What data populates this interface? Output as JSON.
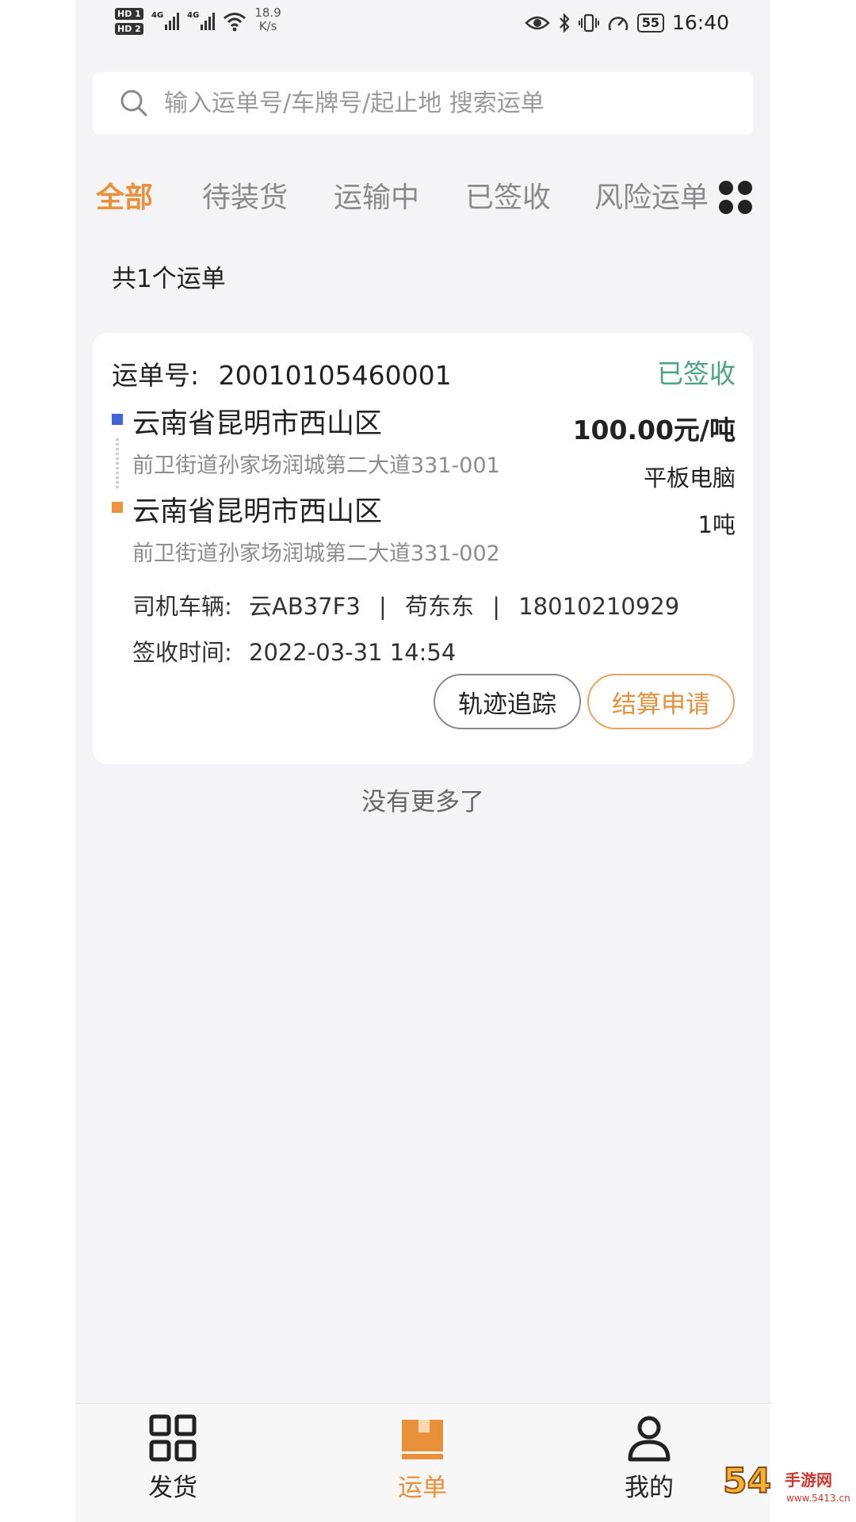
{
  "status_bar": {
    "sim1": "HD 1",
    "sim2": "HD 2",
    "net1": "4G",
    "net2": "4G",
    "speed_value": "18.9",
    "speed_unit": "K/s",
    "battery": "55",
    "time": "16:40"
  },
  "search": {
    "placeholder": "输入运单号/车牌号/起止地 搜索运单"
  },
  "tabs": [
    {
      "label": "全部",
      "active": true
    },
    {
      "label": "待装货",
      "active": false
    },
    {
      "label": "运输中",
      "active": false
    },
    {
      "label": "已签收",
      "active": false
    },
    {
      "label": "风险运单",
      "active": false
    }
  ],
  "summary": {
    "count_text": "共1个运单"
  },
  "waybill": {
    "number_label": "运单号:",
    "number": "20010105460001",
    "status": "已签收",
    "origin": {
      "city": "云南省昆明市西山区",
      "address": "前卫街道孙家场润城第二大道331-001"
    },
    "destination": {
      "city": "云南省昆明市西山区",
      "address": "前卫街道孙家场润城第二大道331-002"
    },
    "price": "100.00元/吨",
    "goods": "平板电脑",
    "weight": "1吨",
    "driver_label": "司机车辆:",
    "plate": "云AB37F3",
    "driver_name": "苟东东",
    "phone": "18010210929",
    "sign_label": "签收时间:",
    "sign_time": "2022-03-31 14:54",
    "track_button": "轨迹追踪",
    "settle_button": "结算申请"
  },
  "footer_text": "没有更多了",
  "bottom_nav": [
    {
      "label": "发货",
      "icon": "grid-apps-icon",
      "active": false
    },
    {
      "label": "运单",
      "icon": "box-icon",
      "active": true
    },
    {
      "label": "我的",
      "icon": "user-icon",
      "active": false
    }
  ],
  "watermark": {
    "big": "54",
    "small": "手游网",
    "url": "www.5413.cn"
  },
  "colors": {
    "accent": "#e9913a",
    "status_green": "#4aa581",
    "origin_blue": "#3f63d9",
    "destination_orange": "#ed9440"
  }
}
